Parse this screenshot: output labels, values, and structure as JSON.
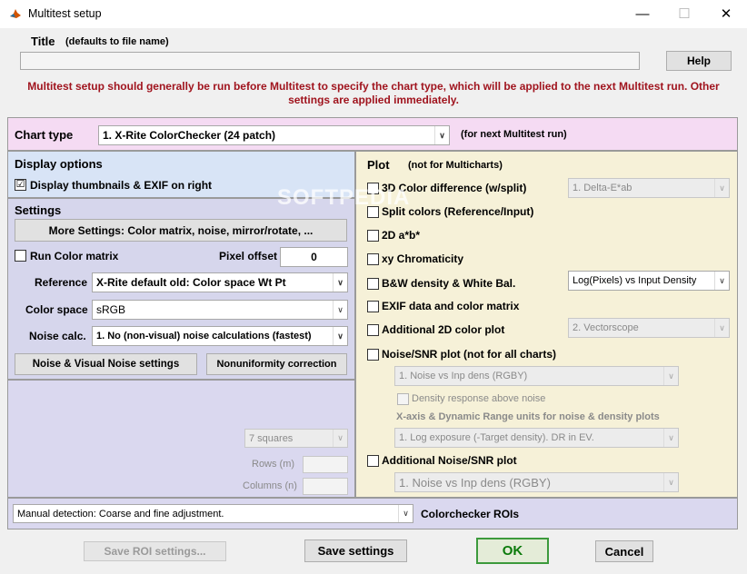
{
  "window": {
    "title": "Multitest setup",
    "controls": {
      "minimize": "—",
      "maximize": "☐",
      "close": "✕"
    }
  },
  "title_section": {
    "label": "Title",
    "hint": "(defaults to file name)",
    "value": "",
    "help_label": "Help"
  },
  "notice": "Multitest setup should generally be run before Multitest to specify the chart type, which will be applied to the next Multitest run. Other settings are applied immediately.",
  "chart_type": {
    "label": "Chart type",
    "selected": "1.  X-Rite ColorChecker (24 patch)",
    "note": "(for next Multitest run)"
  },
  "display_options": {
    "heading": "Display options",
    "thumbnails_label": "Display thumbnails & EXIF on right",
    "thumbnails_checked": "☑"
  },
  "settings": {
    "heading": "Settings",
    "more_settings_label": "More Settings:  Color matrix, noise, mirror/rotate, ...",
    "run_color_matrix_label": "Run Color matrix",
    "pixel_offset_label": "Pixel offset",
    "pixel_offset_value": "0",
    "reference_label": "Reference",
    "reference_value": "X-Rite default old: Color space Wt Pt",
    "color_space_label": "Color space",
    "color_space_value": "sRGB",
    "noise_calc_label": "Noise calc.",
    "noise_calc_value": "1. No (non-visual) noise calculations (fastest)",
    "noise_visual_button": "Noise & Visual Noise settings",
    "nonuniformity_button": "Nonuniformity correction"
  },
  "roi": {
    "squares_value": "7   squares",
    "rows_label": "Rows (m)",
    "rows_value": "",
    "columns_label": "Columns (n)",
    "columns_value": "",
    "detection_value": "Manual detection:   Coarse and fine adjustment.",
    "detection_caption": "Colorchecker ROIs"
  },
  "plot": {
    "heading": "Plot",
    "heading_note": "(not for Multicharts)",
    "options": [
      {
        "label": "3D Color difference (w/split)"
      },
      {
        "label": "Split colors (Reference/Input)"
      },
      {
        "label": "2D a*b*"
      },
      {
        "label": "xy Chromaticity"
      },
      {
        "label": "B&W density & White Bal."
      },
      {
        "label": "EXIF data and color matrix"
      },
      {
        "label": "Additional 2D color plot"
      },
      {
        "label": "Noise/SNR plot (not for all charts)"
      },
      {
        "label": "Additional Noise/SNR plot"
      }
    ],
    "delta_e_select": "1.  Delta-E*ab",
    "bw_density_select": "Log(Pixels) vs Input Density",
    "additional_2d_select": "2. Vectorscope",
    "noise_snr_select": "1.  Noise vs Inp dens (RGBY)",
    "density_response_label": "Density response above noise",
    "xaxis_label": "X-axis & Dynamic Range units for noise & density plots",
    "xaxis_select": "1. Log exposure (-Target density).     DR in EV.",
    "additional_noise_select": "1.  Noise vs Inp dens (RGBY)"
  },
  "footer": {
    "save_roi_label": "Save ROI settings...",
    "save_settings_label": "Save settings",
    "ok_label": "OK",
    "cancel_label": "Cancel"
  },
  "watermark": "SOFTPEDIA",
  "icons": {
    "dropdown_arrow": "∨",
    "app_icon": "matlab-logo-icon"
  },
  "colors": {
    "notice_text": "#a0141e",
    "chart_type_bg": "#f5dbf3",
    "display_bg": "#d8e4f6",
    "settings_bg": "#d6d6ec",
    "plot_bg": "#f6f1d8",
    "ok_text": "#0b7a0b"
  }
}
